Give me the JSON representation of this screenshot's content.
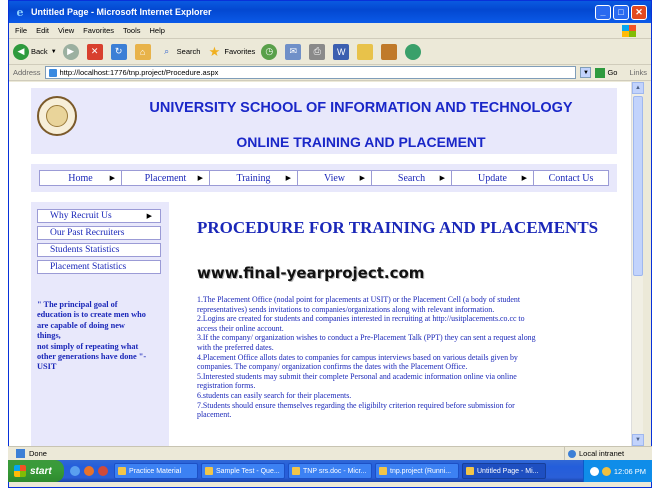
{
  "window": {
    "title": "Untitled Page - Microsoft Internet Explorer"
  },
  "menu": [
    "File",
    "Edit",
    "View",
    "Favorites",
    "Tools",
    "Help"
  ],
  "toolbar": {
    "back": "Back",
    "search": "Search",
    "favorites": "Favorites"
  },
  "address": {
    "label": "Address",
    "url": "http://localhost:1776/tnp.project/Procedure.aspx",
    "go": "Go",
    "links": "Links"
  },
  "header": {
    "title": "UNIVERSITY SCHOOL OF INFORMATION AND TECHNOLOGY",
    "subtitle": "ONLINE TRAINING AND PLACEMENT"
  },
  "nav": [
    {
      "label": "Home",
      "arrow": "▶"
    },
    {
      "label": "Placement",
      "arrow": "▶"
    },
    {
      "label": "Training",
      "arrow": "▶"
    },
    {
      "label": "View",
      "arrow": "▶"
    },
    {
      "label": "Search",
      "arrow": "▶"
    },
    {
      "label": "Update",
      "arrow": "▶"
    },
    {
      "label": "Contact Us",
      "arrow": ""
    }
  ],
  "sidebar": {
    "items": [
      {
        "label": "Why Recruit Us",
        "arrow": "▶"
      },
      {
        "label": "Our Past Recruiters",
        "arrow": ""
      },
      {
        "label": "Students Statistics",
        "arrow": ""
      },
      {
        "label": "Placement Statistics",
        "arrow": ""
      }
    ],
    "quote_lines": [
      "\" The principal goal of",
      "education is to create men who",
      "are capable of doing new",
      "things,",
      "not simply of repeating what",
      "other generations have done \"-",
      "USIT"
    ]
  },
  "main": {
    "title": "PROCEDURE FOR TRAINING AND PLACEMENTS",
    "watermark": "www.final-yearproject.com",
    "lines": [
      "1.The Placement Office (nodal point for placements at USIT) or the Placement Cell (a body of student",
      "representatives) sends invitations to companies/organizations along with relevant information.",
      "2.Logins are created for students and companies interested in recruiting at http://usitplacements.co.cc to",
      "access their online account.",
      "3.If the company/ organization wishes to conduct a Pre-Placement Talk (PPT) they can sent a request along",
      "with the preferred dates.",
      "4.Placement Office allots dates to companies for campus interviews based on various details given by",
      "companies. The company/ organization confirms the dates with the Placement Office.",
      "5.Interested students may submit their complete Personal and academic information online via online",
      "registration forms.",
      "6.students can easily search for their placements.",
      "7.Students should ensure themselves regarding the eligibilty criterion required before submission for",
      "placement."
    ]
  },
  "status": {
    "text": "Done",
    "zone": "Local intranet"
  },
  "taskbar": {
    "start": "start",
    "tasks": [
      {
        "label": "Practice Material",
        "active": false
      },
      {
        "label": "Sample Test - Que...",
        "active": false
      },
      {
        "label": "TNP srs.doc - Micr...",
        "active": false
      },
      {
        "label": "tnp.project (Runni...",
        "active": false
      },
      {
        "label": "Untitled Page - Mi...",
        "active": true
      }
    ],
    "clock": "12:06 PM"
  }
}
